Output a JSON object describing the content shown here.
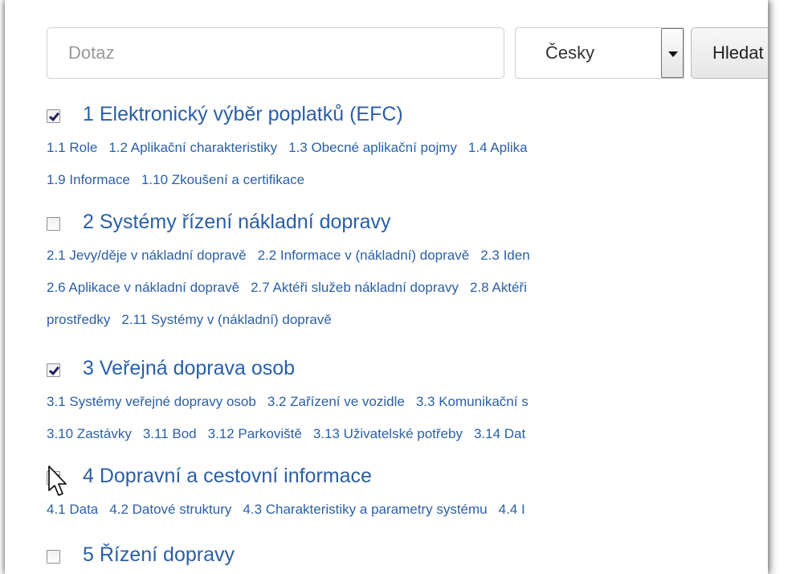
{
  "search": {
    "placeholder": "Dotaz",
    "language": "Česky",
    "button": "Hledat"
  },
  "categories": [
    {
      "title": "1 Elektronický výběr poplatků (EFC)",
      "checked": true,
      "lines": [
        [
          "1.1 Role",
          "1.2 Aplikační charakteristiky",
          "1.3 Obecné aplikační pojmy",
          "1.4 Aplika"
        ],
        [
          "1.9 Informace",
          "1.10 Zkoušení a certifikace"
        ]
      ]
    },
    {
      "title": "2 Systémy řízení nákladní dopravy",
      "checked": false,
      "lines": [
        [
          "2.1 Jevy/děje v nákladní dopravě",
          "2.2 Informace v (nákladní) dopravě",
          "2.3 Iden"
        ],
        [
          "2.6 Aplikace v nákladní dopravě",
          "2.7 Aktéři služeb nákladní dopravy",
          "2.8 Aktéři"
        ],
        [
          "prostředky",
          "2.11 Systémy v (nákladní) dopravě"
        ]
      ]
    },
    {
      "title": "3 Veřejná doprava osob",
      "checked": true,
      "lines": [
        [
          "3.1 Systémy veřejné dopravy osob",
          "3.2 Zařízení ve vozidle",
          "3.3 Komunikační s"
        ],
        [
          "3.10 Zastávky",
          "3.11 Bod",
          "3.12 Parkoviště",
          "3.13 Uživatelské potřeby",
          "3.14 Dat"
        ]
      ]
    },
    {
      "title": "4 Dopravní a cestovní informace",
      "checked": true,
      "lines": [
        [
          "4.1 Data",
          "4.2 Datové struktury",
          "4.3 Charakteristiky a parametry systému",
          "4.4 I"
        ]
      ]
    },
    {
      "title": "5 Řízení dopravy",
      "checked": false,
      "lines": []
    }
  ]
}
